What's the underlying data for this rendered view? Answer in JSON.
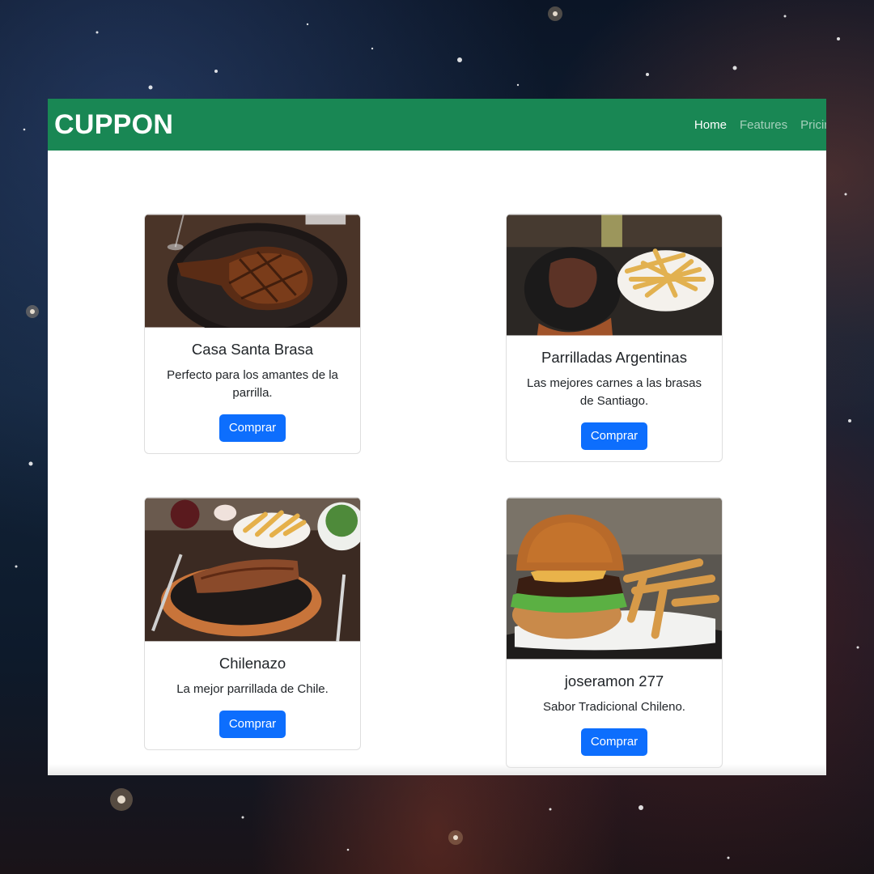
{
  "navbar": {
    "brand": "CUPPON",
    "links": [
      {
        "label": "Home",
        "active": true
      },
      {
        "label": "Features",
        "active": false
      },
      {
        "label": "Pricing",
        "active": false
      }
    ]
  },
  "cards": [
    {
      "title": "Casa Santa Brasa",
      "text": "Perfecto para los amantes de la parrilla.",
      "button": "Comprar"
    },
    {
      "title": "Parrilladas Argentinas",
      "text": "Las mejores carnes a las brasas de Santiago.",
      "button": "Comprar"
    },
    {
      "title": "Chilenazo",
      "text": "La mejor parrillada de Chile.",
      "button": "Comprar"
    },
    {
      "title": "joseramon 277",
      "text": "Sabor Tradicional Chileno.",
      "button": "Comprar"
    }
  ],
  "colors": {
    "navbar": "#198754",
    "button": "#0d6efd"
  }
}
